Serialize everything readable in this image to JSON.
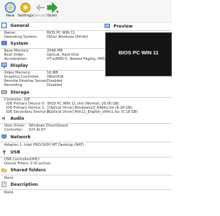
{
  "toolbar": {
    "new_label": "New",
    "settings_label": "Settings",
    "discard_label": "Discard",
    "start_label": "Start"
  },
  "general": {
    "title": "General",
    "name_key": "Name:",
    "name_val": "BIOS PC WIN 11",
    "os_key": "Operating System:",
    "os_val": "Other Windows (64-bit)"
  },
  "system": {
    "title": "System",
    "mem_key": "Base Memory:",
    "mem_val": "2048 MB",
    "boot_key": "Boot Order:",
    "boot_val": "Optical, Hard Disk",
    "accel_key": "Acceleration:",
    "accel_val": "VT-x/AMD-V, Nested Paging, PAE/NX"
  },
  "display": {
    "title": "Display",
    "vmem_key": "Video Memory:",
    "vmem_val": "16 MB",
    "gc_key": "Graphics Controller:",
    "gc_val": "VBoxVGA",
    "rds_key": "Remote Desktop Server:",
    "rds_val": "Disabled",
    "rec_key": "Recording:",
    "rec_val": "Disabled"
  },
  "storage": {
    "title": "Storage",
    "ctrl": "Controller: IDE",
    "pm_key": "IDE Primary Device 0:",
    "pm_val": "BIOS PC WIN 11.vhd (Normal, 20.00 GB)",
    "ps_key": "IDE Primary Device 1:",
    "ps_val": "[Optical Drive] Windows10_64bits.iso (4.28 GB)",
    "sm_key": "IDE Secondary Device 0:",
    "sm_val": "[Optical Drive] Win11_English_x64v1.iso (5.18 GB)"
  },
  "audio": {
    "title": "Audio",
    "host_key": "Host Driver:",
    "host_val": "Windows DirectSound",
    "ctrl_key": "Controller:",
    "ctrl_val": "ICH AC97"
  },
  "network": {
    "title": "Network",
    "adapter": "Adapter 1:   Intel PRO/1000 MT Desktop (NAT)"
  },
  "usb": {
    "title": "USB",
    "ctrl_key": "USB Controller:",
    "ctrl_val": "OHCI",
    "filters_key": "Device Filters:",
    "filters_val": "0 (0 active)"
  },
  "shared": {
    "title": "Shared folders",
    "value": "None"
  },
  "description": {
    "title": "Description",
    "value": "None"
  },
  "preview": {
    "title": "Preview",
    "screen_text": "BIOS PC WIN 11"
  },
  "colors": {
    "accent_blue": "#2a6fc9",
    "start_green": "#3ba53b",
    "preview_bg": "#141414"
  }
}
